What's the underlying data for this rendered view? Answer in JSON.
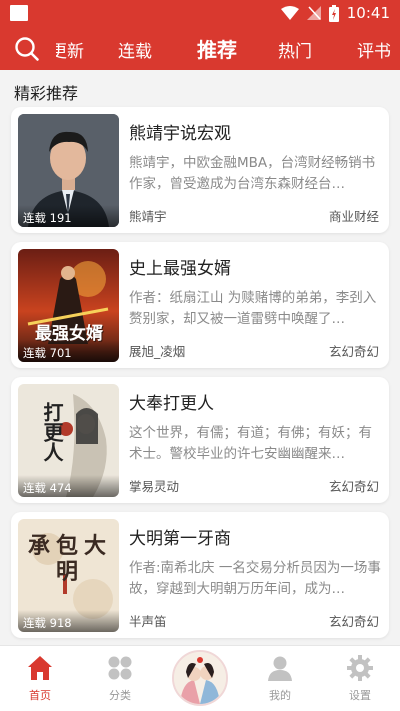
{
  "status_bar": {
    "time": "10:41"
  },
  "top_nav": {
    "tabs": [
      {
        "label": "更新"
      },
      {
        "label": "连载"
      },
      {
        "label": "推荐"
      },
      {
        "label": "热门"
      },
      {
        "label": "评书"
      }
    ]
  },
  "section": {
    "title": "精彩推荐"
  },
  "books": [
    {
      "title": "熊靖宇说宏观",
      "description": "熊靖宇，中欧金融MBA，台湾财经畅销书作家，曾受邀成为台湾东森财经台…",
      "author": "熊靖宇",
      "genre": "商业财经",
      "badge": "连载 191"
    },
    {
      "title": "史上最强女婿",
      "description": "作者：纸扇江山 为赎赌博的弟弟，李刭入赘别家，却又被一道雷劈中唤醒了…",
      "author": "展旭_凌烟",
      "genre": "玄幻奇幻",
      "badge": "连载 701",
      "cover_text": "最强女婿"
    },
    {
      "title": "大奉打更人",
      "description": "这个世界，有儒；有道；有佛；有妖；有术士。警校毕业的许七安幽幽醒来…",
      "author": "掌易灵动",
      "genre": "玄幻奇幻",
      "badge": "连载 474",
      "cover_text": "打更人"
    },
    {
      "title": "大明第一牙商",
      "description": "作者:南希北庆 一名交易分析员因为一场事故，穿越到大明朝万历年间，成为…",
      "author": "半声笛",
      "genre": "玄幻奇幻",
      "badge": "连载 918",
      "cover_text": "承包大明"
    }
  ],
  "bottom_nav": {
    "items": [
      {
        "label": "首页"
      },
      {
        "label": "分类"
      },
      {
        "label": "我的"
      },
      {
        "label": "设置"
      }
    ]
  },
  "colors": {
    "brand": "#d9392f",
    "muted": "#8a8a8a",
    "icon_gray": "#c2c2c2"
  }
}
